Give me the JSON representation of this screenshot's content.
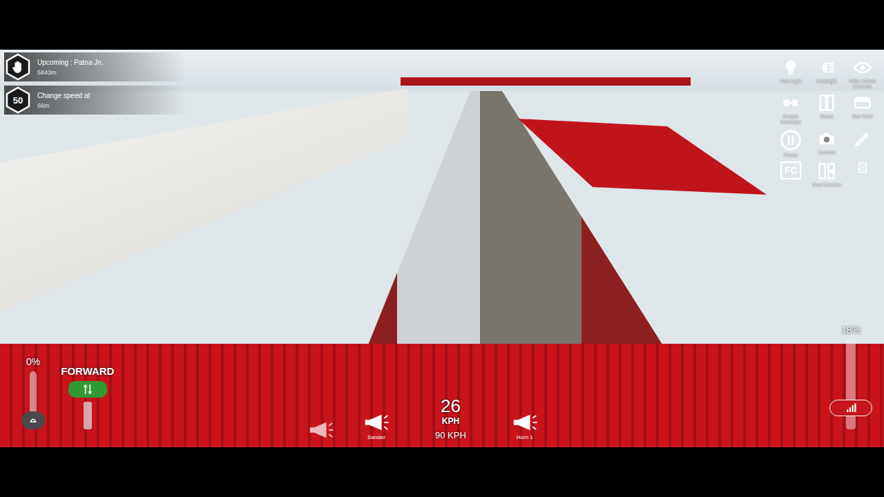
{
  "upcoming": {
    "label": "Upcoming : Patna Jn.",
    "distance": "5843m"
  },
  "speed_change": {
    "limit": "50",
    "label": "Change speed at",
    "distance": "66m"
  },
  "right_controls": [
    {
      "kind": "bulb",
      "label": "Cab Light"
    },
    {
      "kind": "headlight",
      "label": "Headlight"
    },
    {
      "kind": "eye",
      "label": "Hide / Show Controls"
    },
    {
      "kind": "coupler",
      "label": "Couple Uncouple"
    },
    {
      "kind": "doors",
      "label": "Doors"
    },
    {
      "kind": "visor",
      "label": "Sun Visor"
    },
    {
      "kind": "pause",
      "label": "Pause"
    },
    {
      "kind": "camera",
      "label": "Camera"
    },
    {
      "kind": "pen"
    },
    {
      "kind": "glyph",
      "glyph": "FC"
    },
    {
      "kind": "doorcam",
      "label": "Door Camera"
    },
    {
      "kind": "list"
    }
  ],
  "throttle": {
    "reading": "0%",
    "level": 0
  },
  "reverser": {
    "label": "FORWARD"
  },
  "brake": {
    "reading": "18%",
    "level": 0.18
  },
  "bottom_left_buttons": [
    {
      "kind": "horn-alt"
    },
    {
      "kind": "sander",
      "label": "Sander"
    }
  ],
  "speedometer": {
    "speed": "26",
    "unit": "KPH",
    "limit": "90 KPH"
  },
  "bottom_right_buttons": [
    {
      "kind": "horn",
      "label": "Horn 1"
    }
  ]
}
